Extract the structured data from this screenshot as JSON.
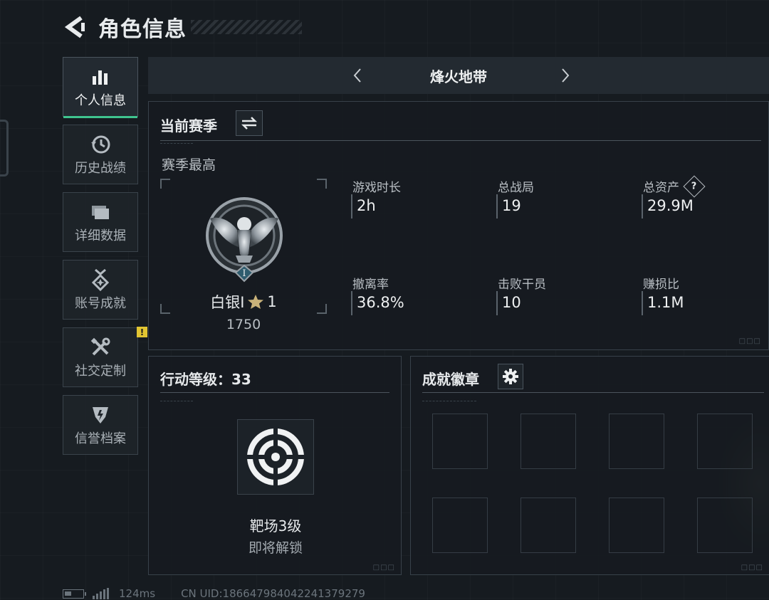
{
  "header": {
    "title": "角色信息"
  },
  "sidebar": {
    "items": [
      {
        "label": "个人信息",
        "icon": "bar-chart-icon",
        "active": true
      },
      {
        "label": "历史战绩",
        "icon": "history-clock-icon"
      },
      {
        "label": "详细数据",
        "icon": "folder-icon"
      },
      {
        "label": "账号成就",
        "icon": "medal-icon"
      },
      {
        "label": "社交定制",
        "icon": "tools-icon",
        "alert": "!"
      },
      {
        "label": "信誉档案",
        "icon": "shield-emblem-icon"
      }
    ]
  },
  "mode_bar": {
    "name": "烽火地带"
  },
  "season": {
    "title": "当前赛季",
    "subtitle": "赛季最高",
    "rank_name": "白银Ⅰ",
    "rank_stars": "1",
    "rank_tier": "Ⅰ",
    "rank_score": "1750",
    "stats": [
      {
        "label": "游戏时长",
        "value": "2h"
      },
      {
        "label": "总战局",
        "value": "19"
      },
      {
        "label": "总资产",
        "value": "29.9M",
        "help": "?"
      },
      {
        "label": "撤离率",
        "value": "36.8%"
      },
      {
        "label": "击败干员",
        "value": "10"
      },
      {
        "label": "赚损比",
        "value": "1.1M"
      }
    ]
  },
  "level": {
    "title": "行动等级：33",
    "unlock_name": "靶场3级",
    "unlock_status": "即将解锁"
  },
  "badges": {
    "title": "成就徽章"
  },
  "status": {
    "ping": "124ms",
    "uid": "CN UID:18664798404224137927​9"
  },
  "colors": {
    "accent_green": "#3fc48f",
    "alert_yellow": "#e2c532",
    "background": "#161b20"
  }
}
